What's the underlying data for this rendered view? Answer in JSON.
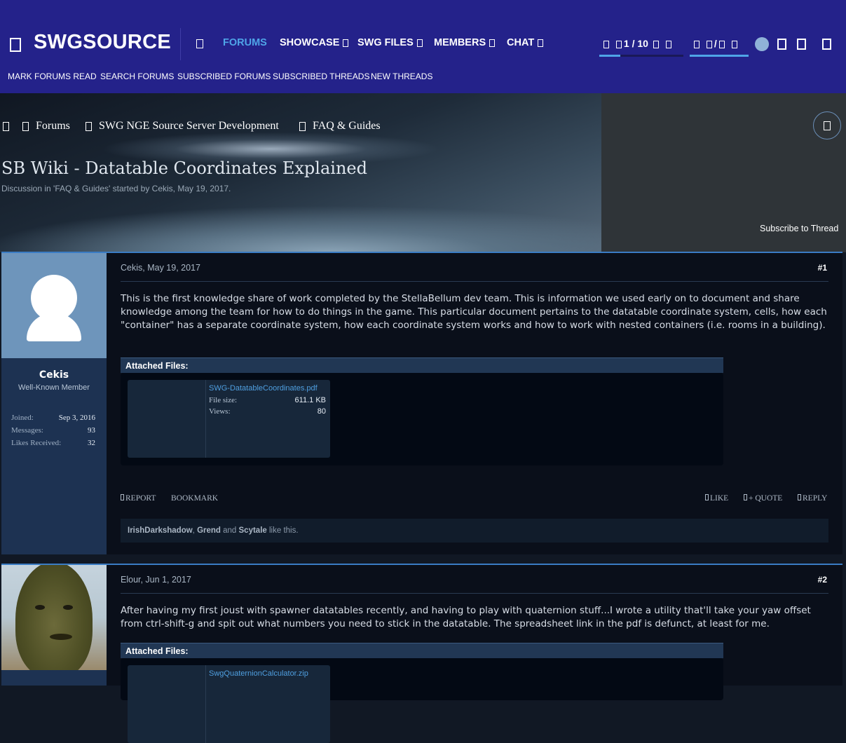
{
  "header": {
    "logo": "SWGSOURCE",
    "nav": [
      {
        "label": "FORUMS",
        "active": true
      },
      {
        "label": "SHOWCASE"
      },
      {
        "label": "SWG FILES"
      },
      {
        "label": "MEMBERS"
      },
      {
        "label": "CHAT"
      }
    ],
    "page_counter": "1 / 10",
    "second_counter": "/",
    "subnav": [
      "MARK FORUMS READ",
      "SEARCH FORUMS",
      "SUBSCRIBED FORUMS",
      "SUBSCRIBED THREADS",
      "NEW THREADS"
    ],
    "colors": {
      "bar": "#24228a",
      "accent": "#4fa5e8"
    }
  },
  "breadcrumb": [
    "Forums",
    "SWG NGE Source Server Development",
    "FAQ & Guides"
  ],
  "thread": {
    "title": "SB Wiki - Datatable Coordinates Explained",
    "subtitle": "Discussion in 'FAQ & Guides' started by Cekis, May 19, 2017.",
    "subscribe_label": "Subscribe to Thread"
  },
  "posts": [
    {
      "author": "Cekis",
      "user_title": "Well-Known Member",
      "stats": [
        {
          "label": "Joined:",
          "value": "Sep 3, 2016"
        },
        {
          "label": "Messages:",
          "value": "93"
        },
        {
          "label": "Likes Received:",
          "value": "32"
        }
      ],
      "date": "Cekis, May 19, 2017",
      "number": "#1",
      "body": "This is the first knowledge share of work completed by the StellaBellum dev team. This is information we used early on to document and share knowledge among the team for how to do things in the game. This particular document pertains to the datatable coordinate system, cells, how each \"container\" has a separate coordinate system, how each coordinate system works and how to work with nested containers (i.e. rooms in a building).",
      "attachments_label": "Attached Files:",
      "attachment": {
        "name": "SWG-DatatableCoordinates.pdf",
        "size_label": "File size:",
        "size": "611.1 KB",
        "views_label": "Views:",
        "views": "80"
      },
      "actions_left": [
        "REPORT",
        "BOOKMARK"
      ],
      "actions_right": [
        "LIKE",
        "+ QUOTE",
        "REPLY"
      ],
      "likes": {
        "names": [
          "IrishDarkshadow",
          "Grend",
          "Scytale"
        ],
        "sep1": ", ",
        "sep2": " and ",
        "suffix": " like this."
      }
    },
    {
      "date": "Elour, Jun 1, 2017",
      "number": "#2",
      "body": "After having my first joust with spawner datatables recently, and having to play with quaternion stuff...I wrote a utility that'll take your yaw offset from ctrl-shift-g and spit out what numbers you need to stick in the datatable. The spreadsheet link in the pdf is defunct, at least for me.",
      "attachments_label": "Attached Files:",
      "attachment": {
        "name": "SwgQuaternionCalculator.zip"
      }
    }
  ]
}
